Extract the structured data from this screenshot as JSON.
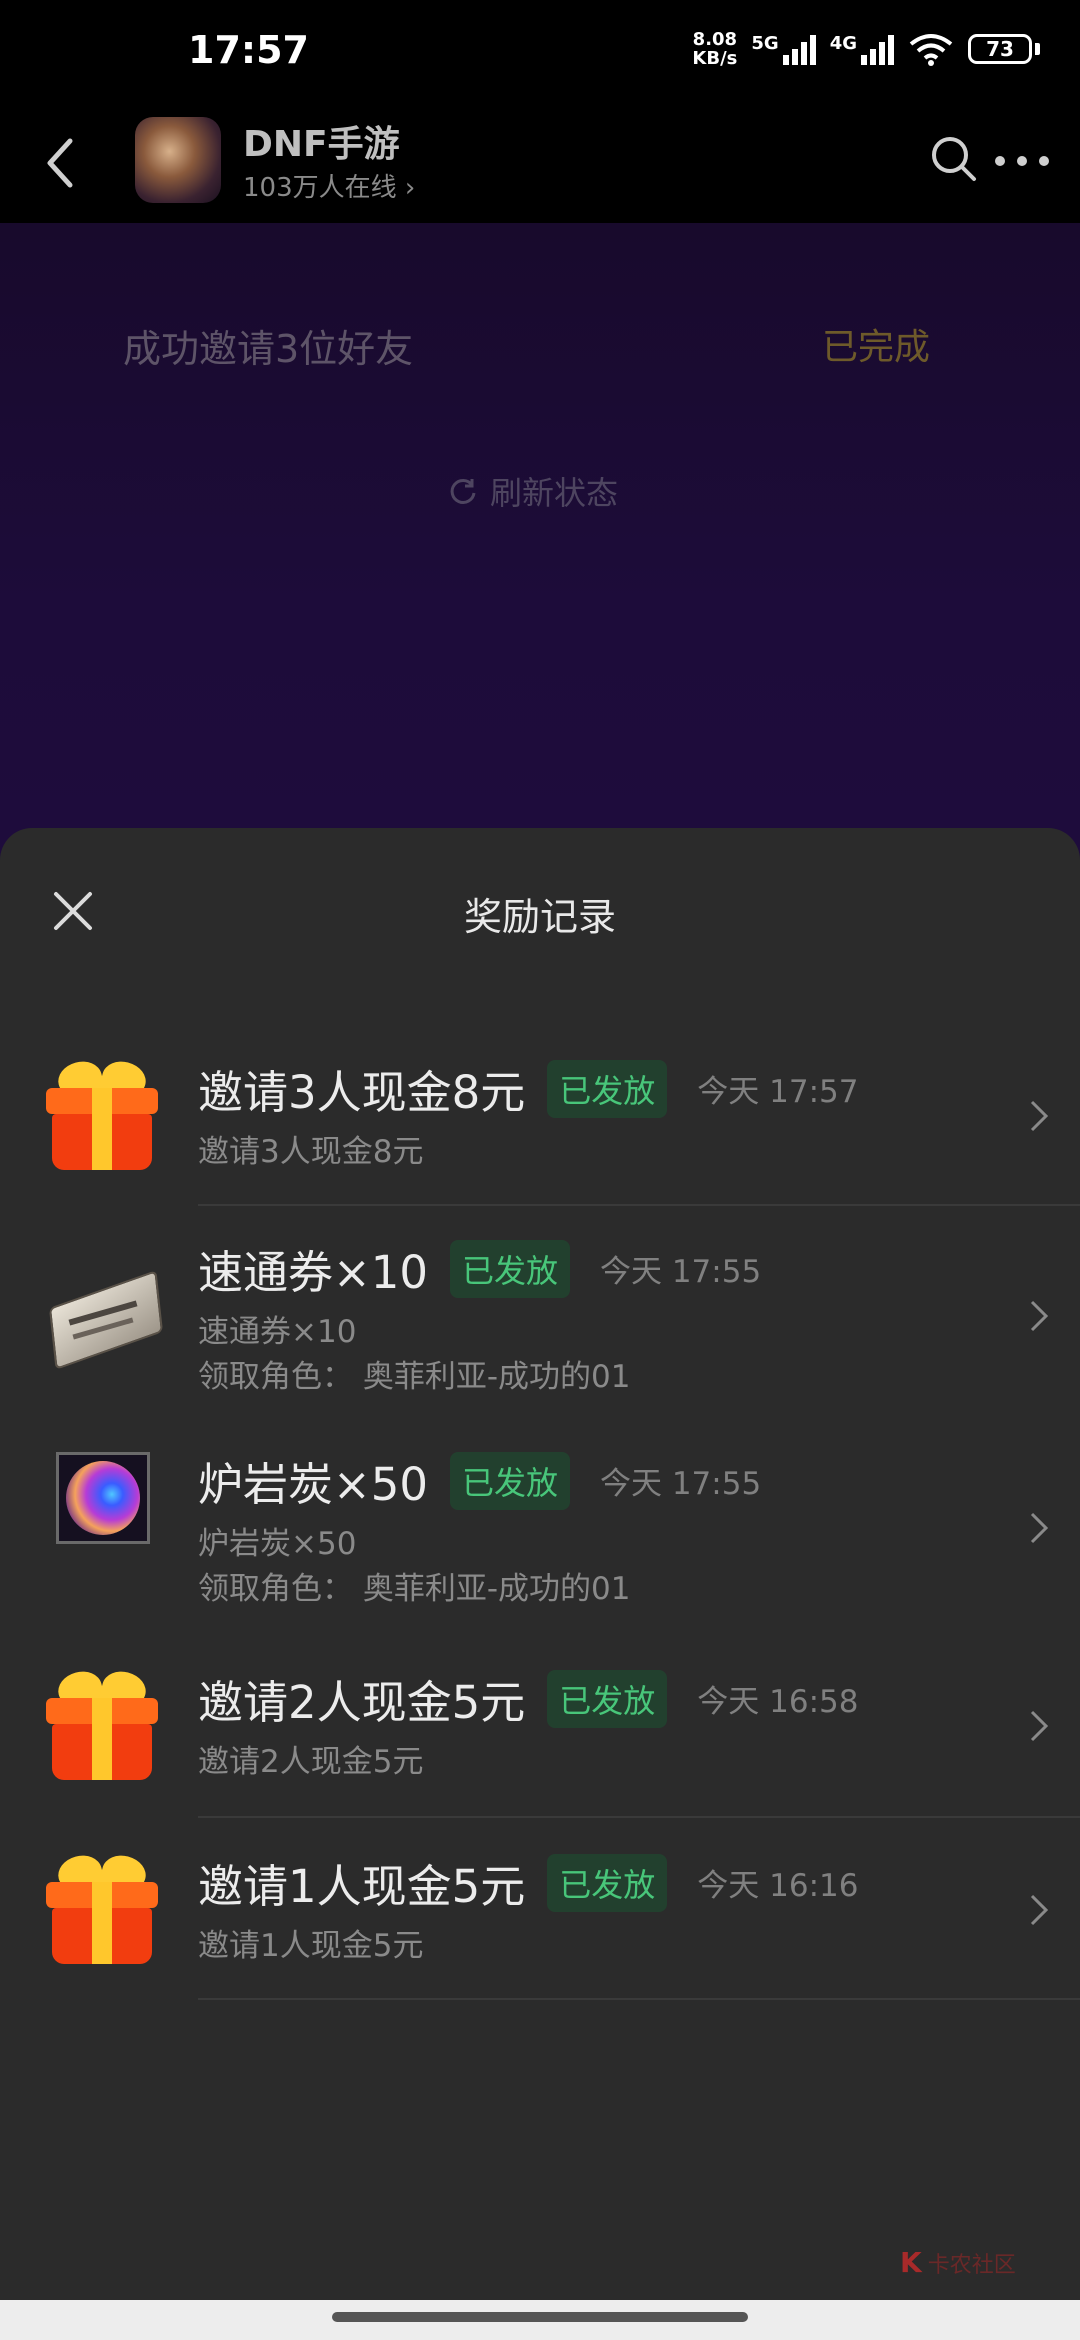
{
  "status_bar": {
    "time": "17:57",
    "net_speed_value": "8.08",
    "net_speed_unit": "KB/s",
    "network_5g": "5G",
    "network_4g": "4G",
    "battery": "73"
  },
  "header": {
    "title": "DNF手游",
    "subtitle": "103万人在线 ›"
  },
  "background": {
    "task_label": "成功邀请3位好友",
    "task_status": "已完成",
    "refresh_label": "刷新状态"
  },
  "sheet": {
    "title": "奖励记录",
    "records": [
      {
        "icon": "gift-icon",
        "title": "邀请3人现金8元",
        "badge": "已发放",
        "time": "今天 17:57",
        "detail": "邀请3人现金8元"
      },
      {
        "icon": "ticket-icon",
        "title": "速通券×10",
        "badge": "已发放",
        "time": "今天 17:55",
        "detail": "速通券×10",
        "role": "领取角色：  奥菲利亚-成功的01"
      },
      {
        "icon": "orb-icon",
        "title": "炉岩炭×50",
        "badge": "已发放",
        "time": "今天 17:55",
        "detail": "炉岩炭×50",
        "role": "领取角色：  奥菲利亚-成功的01"
      },
      {
        "icon": "gift-icon",
        "title": "邀请2人现金5元",
        "badge": "已发放",
        "time": "今天 16:58",
        "detail": "邀请2人现金5元"
      },
      {
        "icon": "gift-icon",
        "title": "邀请1人现金5元",
        "badge": "已发放",
        "time": "今天 16:16",
        "detail": "邀请1人现金5元"
      }
    ]
  },
  "watermark": {
    "logo": "K",
    "text": "卡农社区"
  },
  "colors": {
    "badge_text": "#48c67a",
    "badge_bg": "#22402e",
    "sheet_bg": "#2b2b2b",
    "task_status": "#6e5a2a"
  }
}
